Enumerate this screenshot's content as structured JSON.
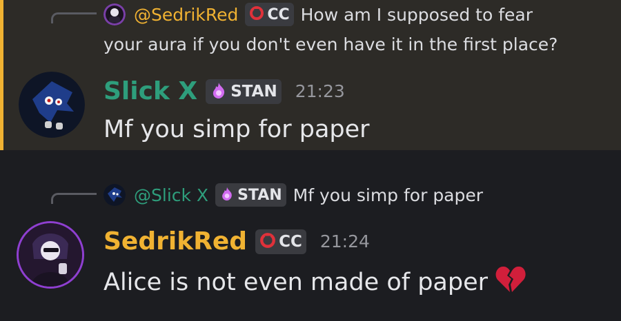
{
  "colors": {
    "sedrik_name": "#f0b232",
    "slick_name": "#2e9e7c",
    "mention_accent": "#f0b232",
    "badge_bg": "#3a3b40",
    "timestamp": "#96979d"
  },
  "messages": [
    {
      "reply": {
        "author": "@SedrikRed",
        "badge_icon": "red-ring-icon",
        "badge": "CC",
        "text_line1": "How am I supposed to fear",
        "text_line2": "your aura if you don't even have it in the first place?"
      },
      "author": "Slick X",
      "badge_icon": "purple-flame-icon",
      "badge": "STAN",
      "time": "21:23",
      "content": "Mf you simp for paper",
      "highlighted": true
    },
    {
      "reply": {
        "author": "@Slick X",
        "badge_icon": "purple-flame-icon",
        "badge": "STAN",
        "text_line1": "Mf you simp for paper"
      },
      "author": "SedrikRed",
      "badge_icon": "red-ring-icon",
      "badge": "CC",
      "time": "21:24",
      "content": "Alice is not even made of paper",
      "emoji": "broken-heart-icon"
    }
  ]
}
